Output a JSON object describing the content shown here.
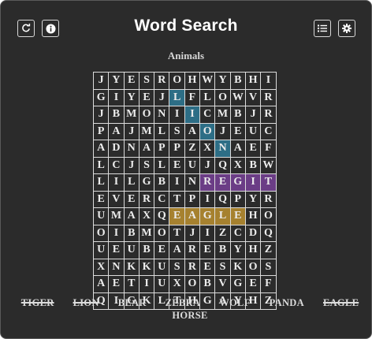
{
  "header": {
    "title": "Word Search",
    "buttons": [
      {
        "name": "refresh-button",
        "icon": "refresh-icon"
      },
      {
        "name": "info-button",
        "icon": "info-icon"
      },
      {
        "name": "word-list-button",
        "icon": "list-icon"
      },
      {
        "name": "settings-button",
        "icon": "gear-icon"
      }
    ]
  },
  "category": "Animals",
  "colors": {
    "background": "#2b2b2b",
    "lion": "#2d6e86",
    "tiger": "#6b3d86",
    "eagle": "#a6812f"
  },
  "grid": {
    "rows": [
      "JYESROHWYBHI",
      "GIYEJLFLOWVR",
      "JBMONIICMBJR",
      "PAJMLSAOJEUC",
      "ADNAPPZXNAEF",
      "LCJSLEUJQXBW",
      "LILGBINREGIT",
      "EVERCTPIQPYR",
      "UMAXQEAGLEHO",
      "OIBMOTJIZCDQ",
      "UEUBEAREBYHZ",
      "XNKKUSRESKOS",
      "AETIUXOBVGEF",
      "QIGKLTHGAYHZ"
    ],
    "highlights": [
      {
        "word": "LION",
        "color": "#2d6e86",
        "cells": [
          [
            1,
            5
          ],
          [
            2,
            6
          ],
          [
            3,
            7
          ],
          [
            4,
            8
          ]
        ]
      },
      {
        "word": "TIGER",
        "color": "#6b3d86",
        "cells": [
          [
            6,
            7
          ],
          [
            6,
            8
          ],
          [
            6,
            9
          ],
          [
            6,
            10
          ],
          [
            6,
            11
          ]
        ]
      },
      {
        "word": "EAGLE",
        "color": "#a6812f",
        "cells": [
          [
            8,
            5
          ],
          [
            8,
            6
          ],
          [
            8,
            7
          ],
          [
            8,
            8
          ],
          [
            8,
            9
          ]
        ]
      }
    ]
  },
  "words": [
    {
      "text": "TIGER",
      "found": true
    },
    {
      "text": "LION",
      "found": true
    },
    {
      "text": "BEAR",
      "found": false
    },
    {
      "text": "ZEBRA",
      "found": false
    },
    {
      "text": "WOLF",
      "found": false
    },
    {
      "text": "PANDA",
      "found": false
    },
    {
      "text": "EAGLE",
      "found": true
    },
    {
      "text": "HORSE",
      "found": false
    }
  ]
}
